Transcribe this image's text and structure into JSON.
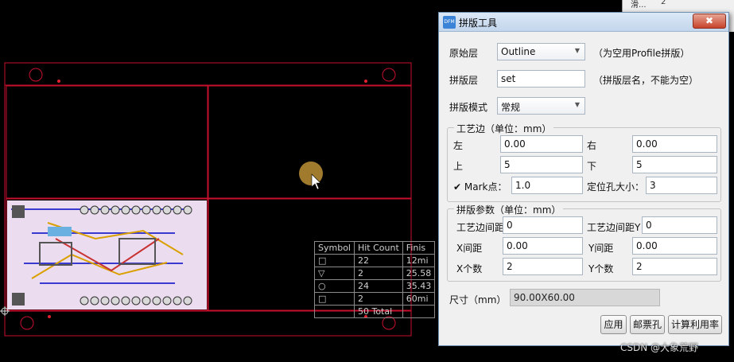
{
  "drill_table": {
    "headers": [
      "Symbol",
      "Hit Count",
      "Finis"
    ],
    "rows": [
      [
        "□",
        "22",
        "12mi"
      ],
      [
        "▽",
        "2",
        "25.58"
      ],
      [
        "○",
        "24",
        "35.43"
      ],
      [
        "□",
        "2",
        "60mi"
      ],
      [
        "",
        "50  Total",
        ""
      ]
    ]
  },
  "bg_window": {
    "row1_label": "滑...",
    "row1_value": "2"
  },
  "dialog": {
    "icon_text": "DFM",
    "title": "拼版工具",
    "close": "✖",
    "original_layer_label": "原始层",
    "original_layer_value": "Outline",
    "original_layer_hint": "（为空用Profile拼版）",
    "panel_layer_label": "拼版层",
    "panel_layer_value": "set",
    "panel_layer_hint": "（拼版层名，不能为空）",
    "mode_label": "拼版模式",
    "mode_value": "常规",
    "process_edge": {
      "title": "工艺边（单位：mm）",
      "left_label": "左",
      "left_value": "0.00",
      "right_label": "右",
      "right_value": "0.00",
      "top_label": "上",
      "top_value": "5",
      "bottom_label": "下",
      "bottom_value": "5",
      "mark_label": "Mark点：",
      "mark_value": "1.0",
      "hole_label": "定位孔大小：",
      "hole_value": "3"
    },
    "panel_params": {
      "title": "拼版参数（单位：mm）",
      "edge_gap_x_label": "工艺边间距X",
      "edge_gap_x_value": "0",
      "edge_gap_y_label": "工艺边间距Y",
      "edge_gap_y_value": "0",
      "x_gap_label": "X间距",
      "x_gap_value": "0.00",
      "y_gap_label": "Y间距",
      "y_gap_value": "0.00",
      "x_count_label": "X个数",
      "x_count_value": "2",
      "y_count_label": "Y个数",
      "y_count_value": "2"
    },
    "size_label": "尺寸（mm）",
    "size_value": "90.00X60.00",
    "apply_button": "应用",
    "stamp_hole_button": "邮票孔",
    "utilization_button": "计算利用率"
  },
  "watermark": "CSDN @大象荒野",
  "colors": {
    "outline": "#c8102e",
    "pad": "#d9d9d9",
    "board": "#e8d8ee"
  }
}
